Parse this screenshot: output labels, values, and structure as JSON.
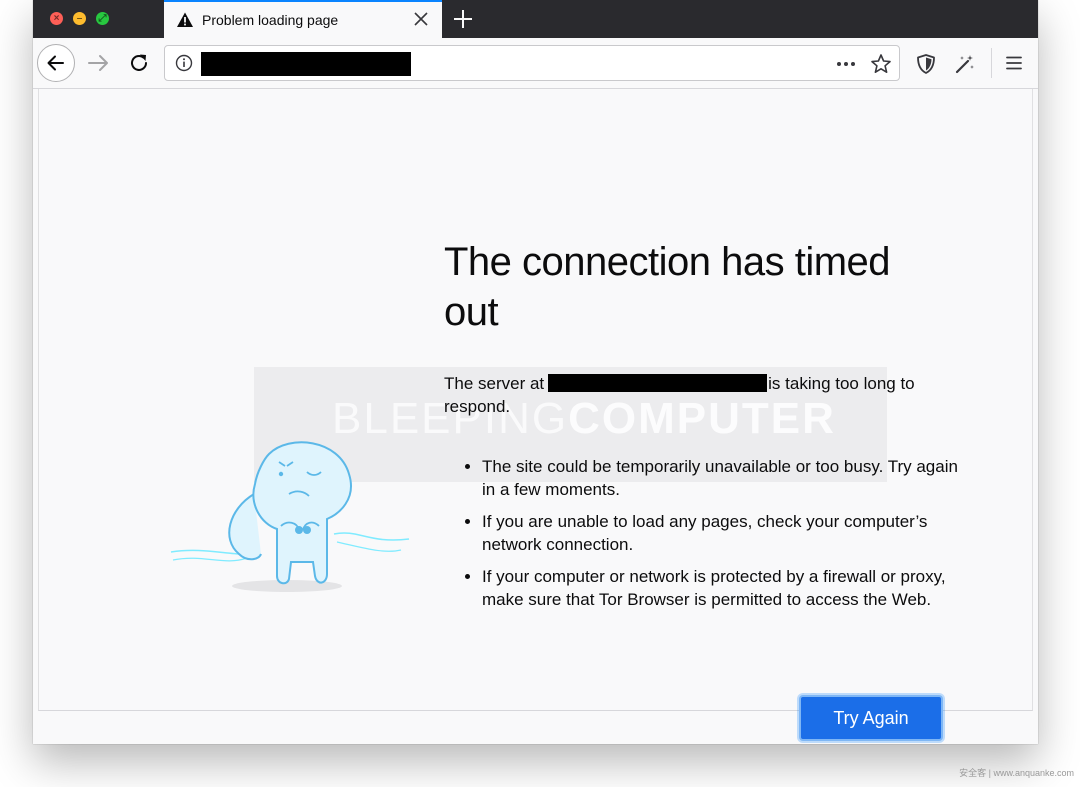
{
  "tab": {
    "title": "Problem loading page"
  },
  "error_page": {
    "title": "The connection has timed out",
    "description_before": "The server at",
    "description_after": "is taking too long to respond.",
    "tips": [
      "The site could be temporarily unavailable or too busy. Try again in a few moments.",
      "If you are unable to load any pages, check your computer’s network connection.",
      "If your computer or network is protected by a firewall or proxy, make sure that Tor Browser is permitted to access the Web."
    ],
    "try_again_label": "Try Again"
  },
  "watermark": {
    "part1": "BLEEPING",
    "part2": "COMPUTER"
  },
  "footer_watermark": "安全客 | www.anquanke.com",
  "icons": {
    "tab_warning": "warning-icon",
    "back": "back-arrow-icon",
    "forward": "forward-arrow-icon",
    "reload": "reload-icon",
    "site_info": "info-icon",
    "page_actions": "more-horizontal-icon",
    "bookmark": "star-icon",
    "tracking": "shield-icon",
    "extension": "magic-wand-icon",
    "menu": "hamburger-menu-icon"
  },
  "colors": {
    "accent": "#1b6ee8",
    "tab_accent": "#0a84ff",
    "titlebar": "#2a2a2e",
    "page_background": "#f9f9fa"
  }
}
